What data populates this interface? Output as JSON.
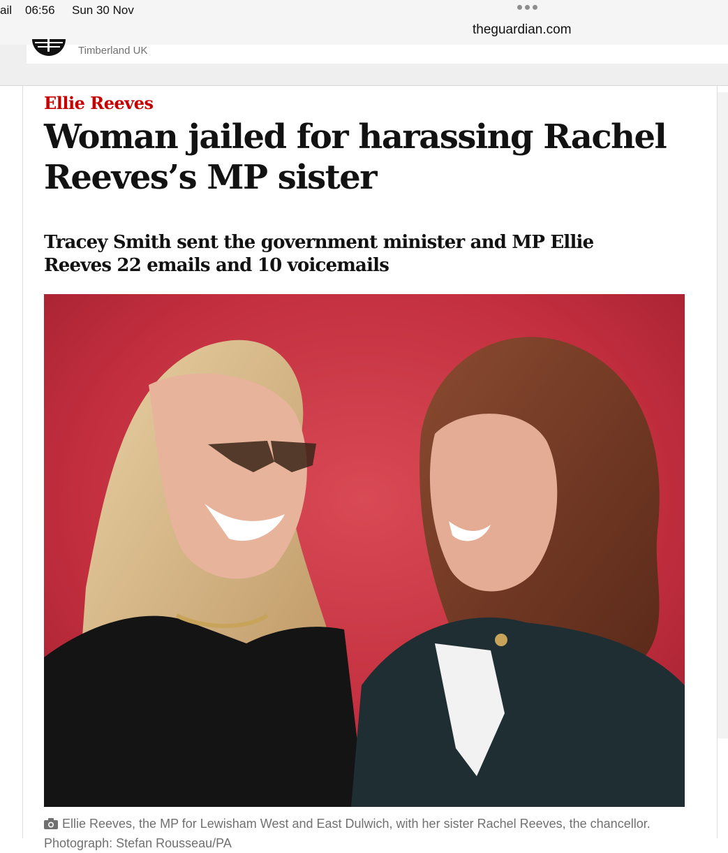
{
  "status_bar": {
    "carrier": "ail",
    "time": "06:56",
    "date": "Sun 30 Nov"
  },
  "browser": {
    "url": "theguardian.com"
  },
  "ad": {
    "brand": "Timberland UK"
  },
  "article": {
    "kicker": "Ellie Reeves",
    "headline": "Woman jailed for harassing Rachel Reeves’s MP sister",
    "standfirst": "Tracey Smith sent the government minister and MP Ellie Reeves 22 emails and 10 voicemails",
    "caption": "Ellie Reeves, the MP for Lewisham West and East Dulwich, with her sister Rachel Reeves, the chancellor. Photograph: Stefan Rousseau/PA"
  },
  "colors": {
    "kicker": "#c70000",
    "headline": "#121212",
    "caption": "#707070",
    "photo_background": "#c22e3e"
  },
  "icons": {
    "camera": "camera-icon",
    "more": "more-dots-icon",
    "ad_logo": "timberland-logo-icon"
  }
}
